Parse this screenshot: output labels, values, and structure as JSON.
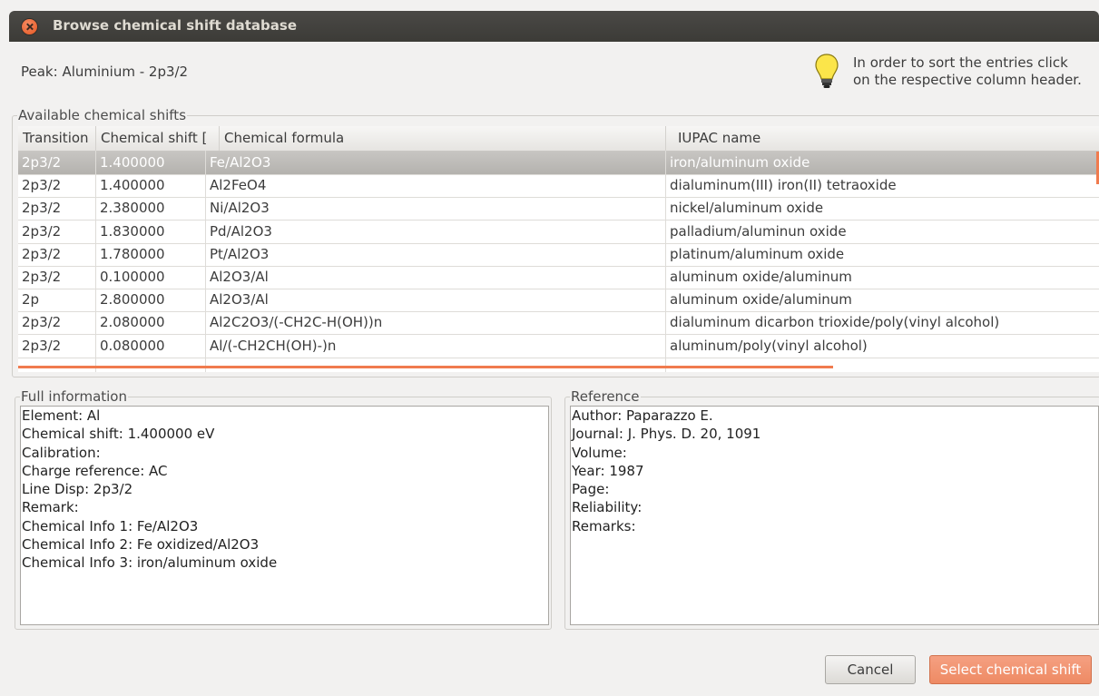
{
  "window": {
    "title": "Browse chemical shift database"
  },
  "peak_label": "Peak: Aluminium - 2p3/2",
  "hint": {
    "line1": "In order to sort the entries click",
    "line2": "on the respective column header."
  },
  "shifts_group": {
    "title": "Available chemical shifts",
    "columns": [
      "Transition",
      "Chemical shift [",
      "Chemical formula",
      "IUPAC name"
    ],
    "rows": [
      [
        "2p3/2",
        "1.400000",
        "Fe/Al2O3",
        "iron/aluminum oxide"
      ],
      [
        "2p3/2",
        "1.400000",
        "Al2FeO4",
        "dialuminum(III) iron(II) tetraoxide"
      ],
      [
        "2p3/2",
        "2.380000",
        "Ni/Al2O3",
        "nickel/aluminum oxide"
      ],
      [
        "2p3/2",
        "1.830000",
        "Pd/Al2O3",
        "palladium/aluminun oxide"
      ],
      [
        "2p3/2",
        "1.780000",
        "Pt/Al2O3",
        "platinum/aluminum oxide"
      ],
      [
        "2p3/2",
        "0.100000",
        "Al2O3/Al",
        "aluminum oxide/aluminum"
      ],
      [
        "2p",
        "2.800000",
        "Al2O3/Al",
        "aluminum oxide/aluminum"
      ],
      [
        "2p3/2",
        "2.080000",
        "Al2C2O3/(-CH2C-H(OH))n",
        "dialuminum dicarbon trioxide/poly(vinyl alcohol)"
      ],
      [
        "2p3/2",
        "0.080000",
        "Al/(-CH2CH(OH)-)n",
        "aluminum/poly(vinyl alcohol)"
      ]
    ],
    "selected_row": 0
  },
  "full_info": {
    "title": "Full information",
    "text": "Element: Al\nChemical shift: 1.400000 eV\nCalibration:\nCharge reference: AC\nLine Disp: 2p3/2\nRemark:\nChemical Info 1: Fe/Al2O3\nChemical Info 2: Fe oxidized/Al2O3\nChemical Info 3: iron/aluminum oxide"
  },
  "reference": {
    "title": "Reference",
    "text": "Author: Paparazzo E.\nJournal: J. Phys. D. 20, 1091\nVolume:\nYear: 1987\nPage:\nReliability:\nRemarks:"
  },
  "buttons": {
    "cancel": "Cancel",
    "select": "Select chemical shift"
  },
  "colors": {
    "accent": "#f07b4e",
    "titlebar": "#3c3b37",
    "selection": "#bdbbb8"
  },
  "icons": {
    "close": "close-icon",
    "hint": "lightbulb-icon"
  }
}
